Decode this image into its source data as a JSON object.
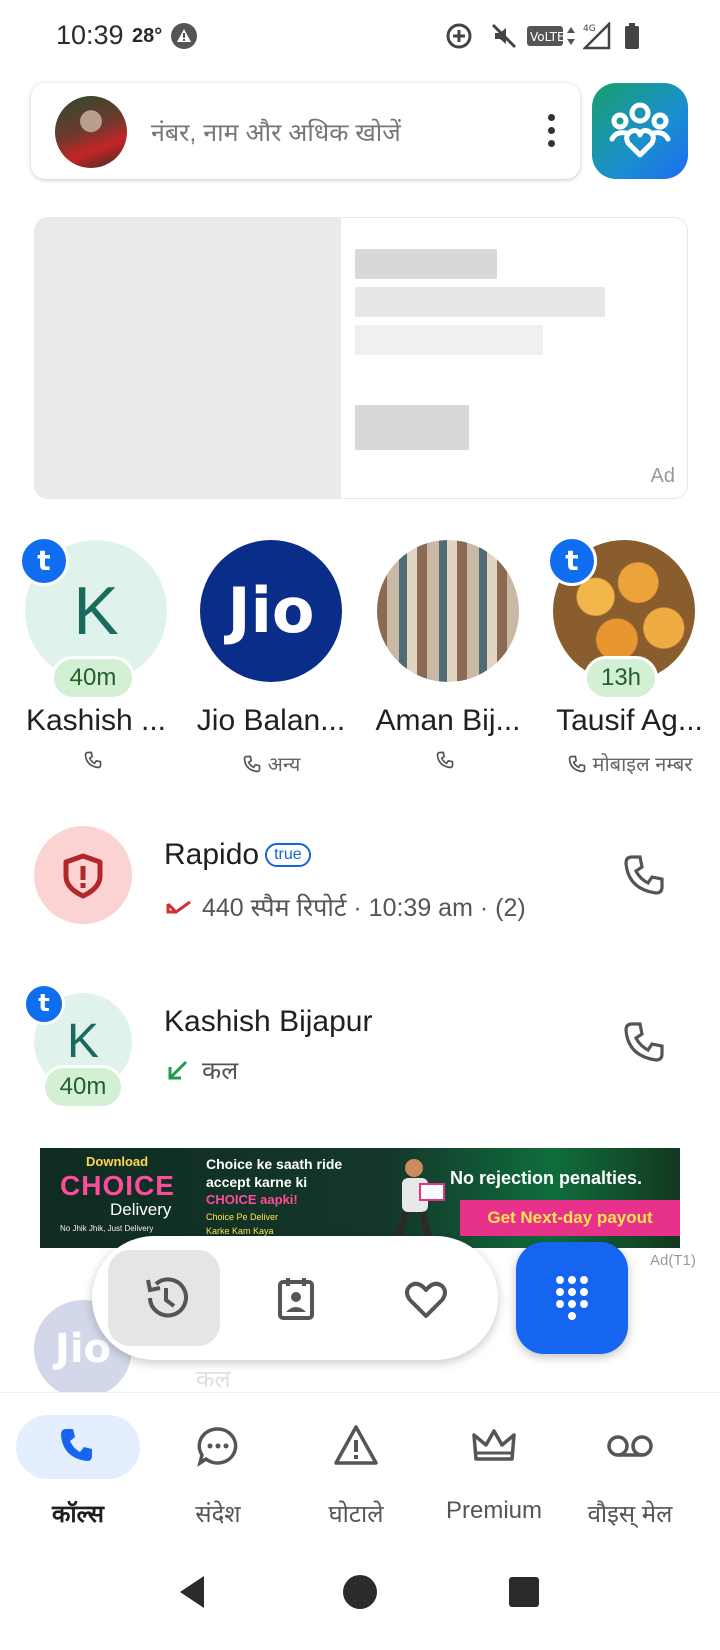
{
  "status_bar": {
    "time": "10:39",
    "temperature": "28°",
    "icons": [
      "alert-icon",
      "data-saver-icon",
      "mute-icon",
      "volte-icon",
      "signal-4g-icon",
      "battery-icon"
    ]
  },
  "search": {
    "placeholder": "नंबर, नाम और अधिक खोजें"
  },
  "ad_card": {
    "label": "Ad"
  },
  "favorites": [
    {
      "name": "Kashish ...",
      "avatar_letter": "K",
      "time": "40m",
      "sub": ""
    },
    {
      "name": "Jio Balan...",
      "avatar_text": "Jio",
      "sub": "अन्य"
    },
    {
      "name": "Aman Bij...",
      "sub": ""
    },
    {
      "name": "Tausif Ag...",
      "time": "13h",
      "sub": "मोबाइल नम्बर"
    }
  ],
  "call_log": [
    {
      "name": "Rapido",
      "badge": "true",
      "detail": "440 स्पैम रिपोर्ट · 10:39 am · (2)",
      "type": "missed-spam"
    },
    {
      "name": "Kashish Bijapur",
      "avatar_letter": "K",
      "time": "40m",
      "detail": "कल",
      "type": "incoming"
    }
  ],
  "banner_ad": {
    "brand_pre": "Download",
    "brand": "CHOICE",
    "brand_sub": "Delivery",
    "tagline": "No Jhik Jhik, Just Delivery",
    "line1": "Choice ke saath ride",
    "line2": "accept karne ki",
    "line3": "CHOICE aapki!",
    "line4": "Choice Pe Deliver",
    "line5": "Karke Kam Kaya",
    "headline": "No rejection penalties.",
    "cta": "Get Next-day payout",
    "label": "Ad(T1)"
  },
  "faded_row": {
    "avatar_text": "Jio",
    "detail": "कल"
  },
  "bottom_nav": [
    {
      "label": "कॉल्स",
      "icon": "phone-icon",
      "active": true
    },
    {
      "label": "संदेश",
      "icon": "message-icon",
      "active": false
    },
    {
      "label": "घोटाले",
      "icon": "warning-icon",
      "active": false
    },
    {
      "label": "Premium",
      "icon": "crown-icon",
      "active": false
    },
    {
      "label": "वौइस् मेल",
      "icon": "voicemail-icon",
      "active": false
    }
  ],
  "colors": {
    "accent": "#1565f0",
    "spam_red": "#d32f2f",
    "pill_green": "#d4f0d4"
  }
}
